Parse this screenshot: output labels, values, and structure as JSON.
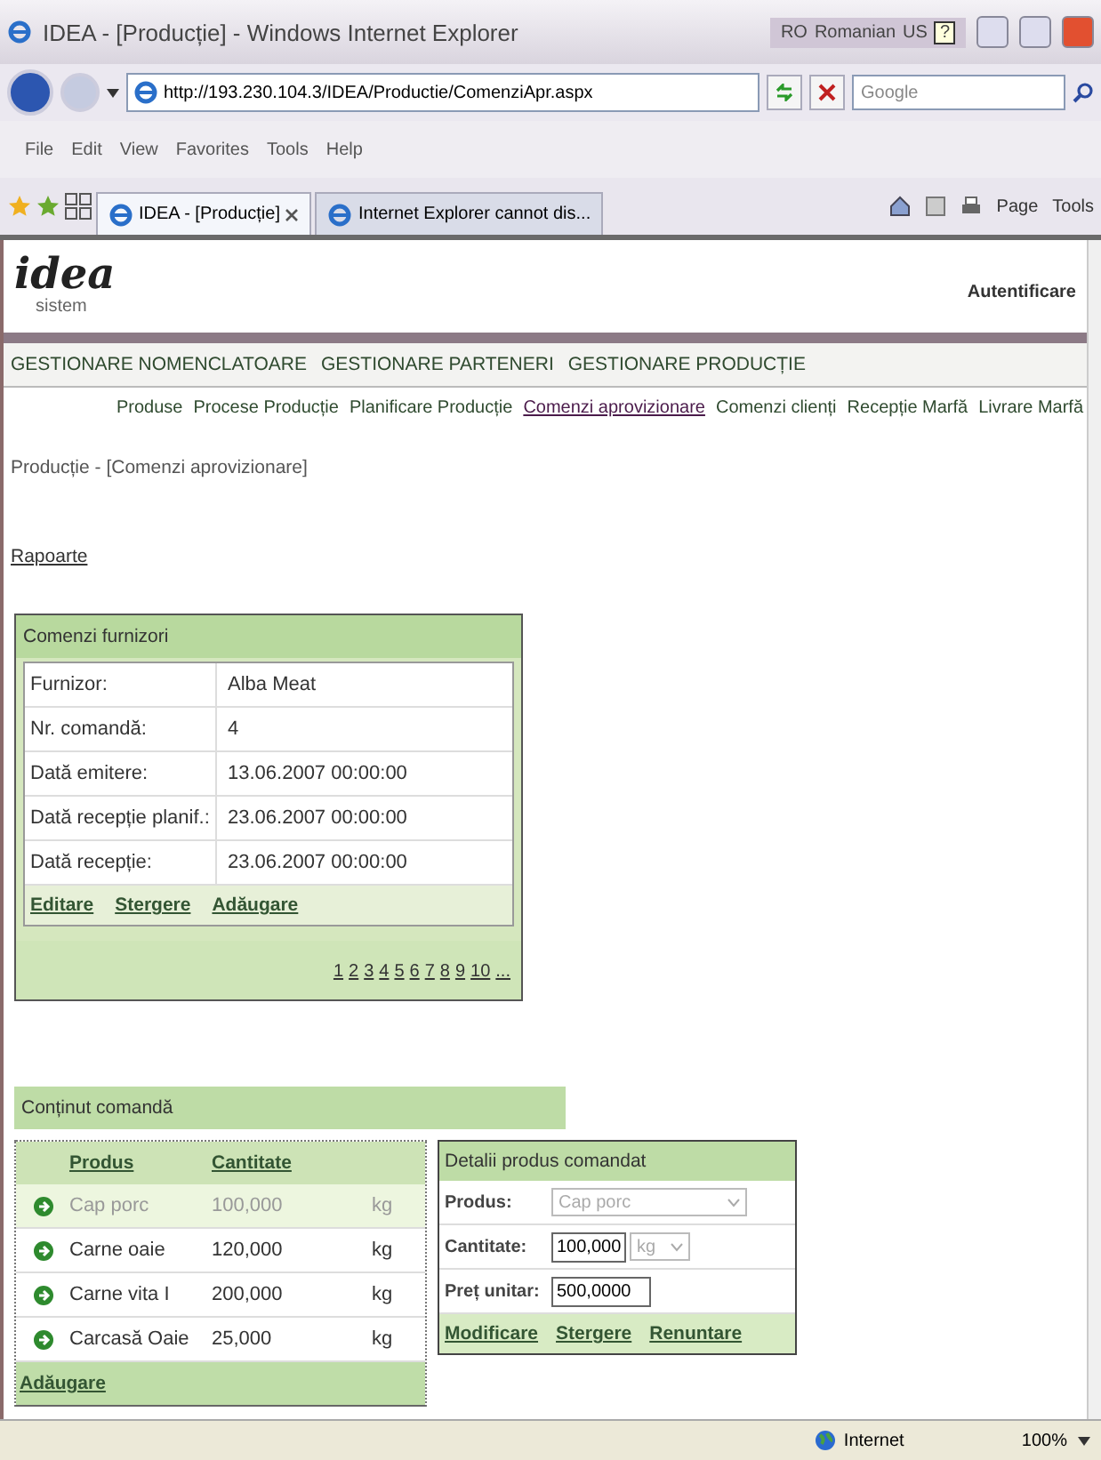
{
  "window": {
    "title": "IDEA - [Producție] - Windows Internet Explorer",
    "language_bar": {
      "code": "RO",
      "language": "Romanian",
      "keyboard": "US",
      "help": "?"
    }
  },
  "address_bar": {
    "url": "http://193.230.104.3/IDEA/Productie/ComenziApr.aspx",
    "search_placeholder": "Google"
  },
  "menu": [
    "File",
    "Edit",
    "View",
    "Favorites",
    "Tools",
    "Help"
  ],
  "tabs": [
    {
      "label": "IDEA - [Producție]",
      "selected": true
    },
    {
      "label": "Internet Explorer cannot dis...",
      "selected": false
    }
  ],
  "command_bar": [
    "Page",
    "Tools"
  ],
  "app": {
    "logo": "idea",
    "logo_subtitle": "sistem",
    "login": "Autentificare"
  },
  "main_nav": [
    "GESTIONARE NOMENCLATOARE",
    "GESTIONARE PARTENERI",
    "GESTIONARE PRODUCȚIE"
  ],
  "sub_nav": [
    {
      "label": "Produse",
      "selected": false
    },
    {
      "label": "Procese Producție",
      "selected": false
    },
    {
      "label": "Planificare Producție",
      "selected": false
    },
    {
      "label": "Comenzi aprovizionare",
      "selected": true
    },
    {
      "label": "Comenzi clienți",
      "selected": false
    },
    {
      "label": "Recepție Marfă",
      "selected": false
    },
    {
      "label": "Livrare Marfă",
      "selected": false
    }
  ],
  "breadcrumb": "Producție - [Comenzi aprovizionare]",
  "reports_link": "Rapoarte",
  "orders_panel": {
    "title": "Comenzi furnizori",
    "fields": [
      {
        "label": "Furnizor:",
        "value": "Alba Meat"
      },
      {
        "label": "Nr. comandă:",
        "value": "4"
      },
      {
        "label": "Dată emitere:",
        "value": "13.06.2007 00:00:00"
      },
      {
        "label": "Dată recepție planif.:",
        "value": "23.06.2007 00:00:00"
      },
      {
        "label": "Dată recepție:",
        "value": "23.06.2007 00:00:00"
      }
    ],
    "actions": [
      "Editare",
      "Stergere",
      "Adăugare"
    ],
    "pages": [
      "1",
      "2",
      "3",
      "4",
      "5",
      "6",
      "7",
      "8",
      "9",
      "10",
      "..."
    ]
  },
  "content_panel": {
    "title": "Conținut comandă",
    "columns": [
      "Produs",
      "Cantitate"
    ],
    "rows": [
      {
        "product": "Cap porc",
        "quantity": "100,000",
        "unit": "kg",
        "selected": true
      },
      {
        "product": "Carne oaie",
        "quantity": "120,000",
        "unit": "kg",
        "selected": false
      },
      {
        "product": "Carne vita I",
        "quantity": "200,000",
        "unit": "kg",
        "selected": false
      },
      {
        "product": "Carcasă Oaie",
        "quantity": "25,000",
        "unit": "kg",
        "selected": false
      }
    ],
    "add_link": "Adăugare"
  },
  "details_panel": {
    "title": "Detalii produs comandat",
    "product": {
      "label": "Produs:",
      "value": "Cap porc",
      "disabled": true
    },
    "quantity": {
      "label": "Cantitate:",
      "value": "100,000",
      "unit": "kg",
      "unit_disabled": true
    },
    "price": {
      "label": "Preț unitar:",
      "value": "500,0000"
    },
    "actions": [
      "Modificare",
      "Stergere",
      "Renuntare"
    ]
  },
  "status_bar": {
    "zone": "Internet",
    "zoom": "100%"
  }
}
